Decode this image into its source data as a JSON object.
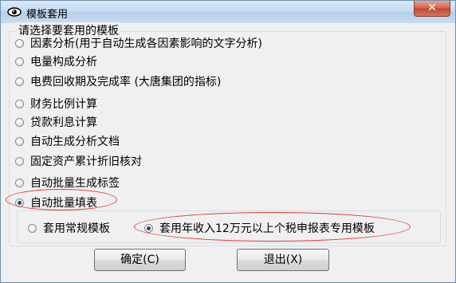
{
  "window": {
    "title": "模板套用",
    "close_label": "✕"
  },
  "group": {
    "title": "请选择要套用的模板"
  },
  "options": [
    {
      "label": "因素分析(用于自动生成各因素影响的文字分析)",
      "checked": false
    },
    {
      "label": "电量构成分析",
      "checked": false
    },
    {
      "label": "电费回收期及完成率 (大唐集团的指标)",
      "checked": false
    },
    {
      "label": "财务比例计算",
      "checked": false
    },
    {
      "label": "贷款利息计算",
      "checked": false
    },
    {
      "label": "自动生成分析文档",
      "checked": false
    },
    {
      "label": "固定资产累计折旧核对",
      "checked": false
    },
    {
      "label": "自动批量生成标签",
      "checked": false
    },
    {
      "label": "自动批量填表",
      "checked": true
    }
  ],
  "sub_options": [
    {
      "label": "套用常规模板",
      "checked": false
    },
    {
      "label": "套用年收入12万元以上个税申报表专用模板",
      "checked": true
    }
  ],
  "buttons": {
    "ok": "确定(C)",
    "cancel": "退出(X)"
  },
  "colors": {
    "annotation": "#e53935",
    "radio_dot": "#1b4a8a"
  }
}
